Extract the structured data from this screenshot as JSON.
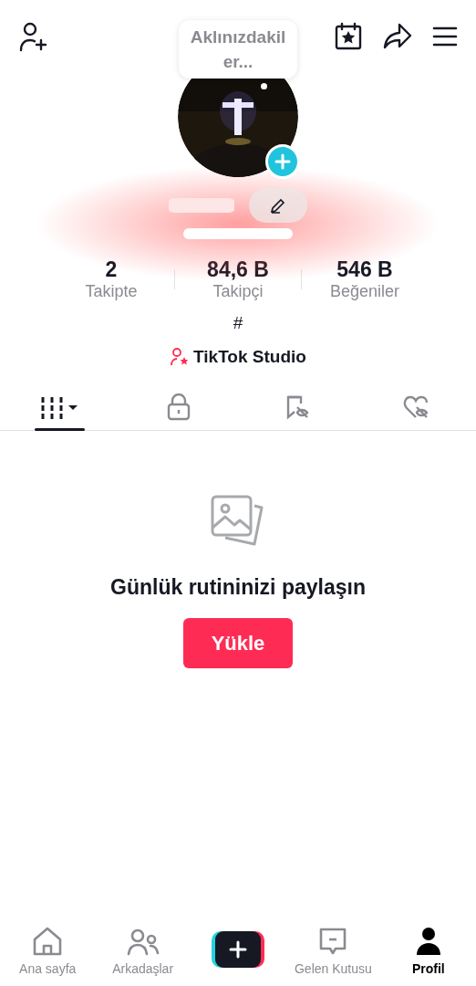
{
  "status_bubble": {
    "text": "Aklınızdakil\ner..."
  },
  "stats": [
    {
      "value": "2",
      "label": "Takipte"
    },
    {
      "value": "84,6 B",
      "label": "Takipçi"
    },
    {
      "value": "546 B",
      "label": "Beğeniler"
    }
  ],
  "bio": "#",
  "studio_link": "TikTok Studio",
  "tabs": [
    {
      "kind": "grid",
      "selected": true
    },
    {
      "kind": "lock",
      "selected": false
    },
    {
      "kind": "bookmark",
      "selected": false
    },
    {
      "kind": "heart",
      "selected": false
    }
  ],
  "empty_state": {
    "title": "Günlük rutininizi paylaşın",
    "button": "Yükle"
  },
  "nav": [
    {
      "kind": "home",
      "label": "Ana sayfa",
      "selected": false
    },
    {
      "kind": "friends",
      "label": "Arkadaşlar",
      "selected": false
    },
    {
      "kind": "create",
      "selected": false
    },
    {
      "kind": "inbox",
      "label": "Gelen Kutusu",
      "selected": false
    },
    {
      "kind": "profile",
      "label": "Profil",
      "selected": true
    }
  ]
}
